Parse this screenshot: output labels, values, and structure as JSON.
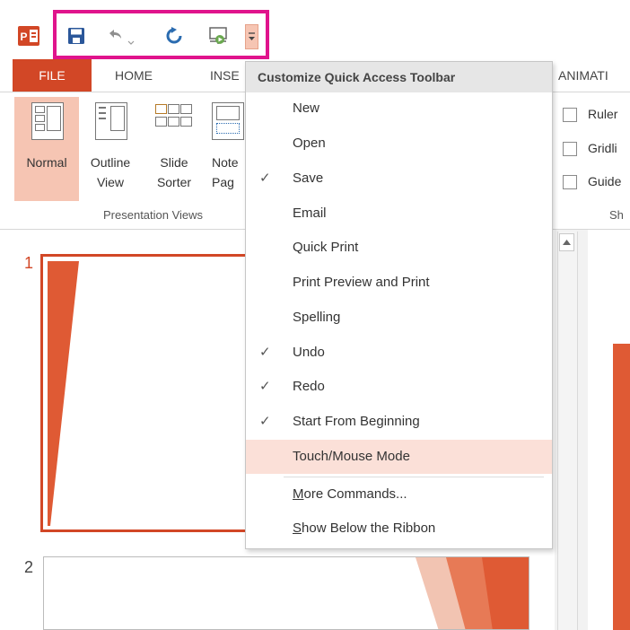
{
  "qat": {
    "app_icon_letter": "P",
    "highlight_color": "#e0148c"
  },
  "ribbon": {
    "tabs": [
      "FILE",
      "HOME",
      "INSE",
      "ANIMATI"
    ],
    "group_label_views": "Presentation Views",
    "group_label_show": "Sh",
    "views": [
      {
        "line1": "Normal",
        "line2": ""
      },
      {
        "line1": "Outline",
        "line2": "View"
      },
      {
        "line1": "Slide",
        "line2": "Sorter"
      },
      {
        "line1": "Note",
        "line2": "Pag"
      }
    ],
    "show_checks": [
      "Ruler",
      "Gridli",
      "Guide"
    ]
  },
  "slides": {
    "numbers": [
      "1",
      "2"
    ]
  },
  "menu": {
    "title": "Customize Quick Access Toolbar",
    "items": [
      {
        "label": "New",
        "checked": false
      },
      {
        "label": "Open",
        "checked": false
      },
      {
        "label": "Save",
        "checked": true
      },
      {
        "label": "Email",
        "checked": false
      },
      {
        "label": "Quick Print",
        "checked": false
      },
      {
        "label": "Print Preview and Print",
        "checked": false
      },
      {
        "label": "Spelling",
        "checked": false
      },
      {
        "label": "Undo",
        "checked": true
      },
      {
        "label": "Redo",
        "checked": true
      },
      {
        "label": "Start From Beginning",
        "checked": true
      },
      {
        "label": "Touch/Mouse Mode",
        "checked": false,
        "highlighted": true
      }
    ],
    "more_commands_pre": "M",
    "more_commands_post": "ore Commands...",
    "show_below_pre": "S",
    "show_below_post": "how Below the Ribbon",
    "check_glyph": "✓"
  },
  "colors": {
    "accent": "#d24726",
    "slide_accent": "#df5a34",
    "highlight_row": "#fbe0d8"
  }
}
